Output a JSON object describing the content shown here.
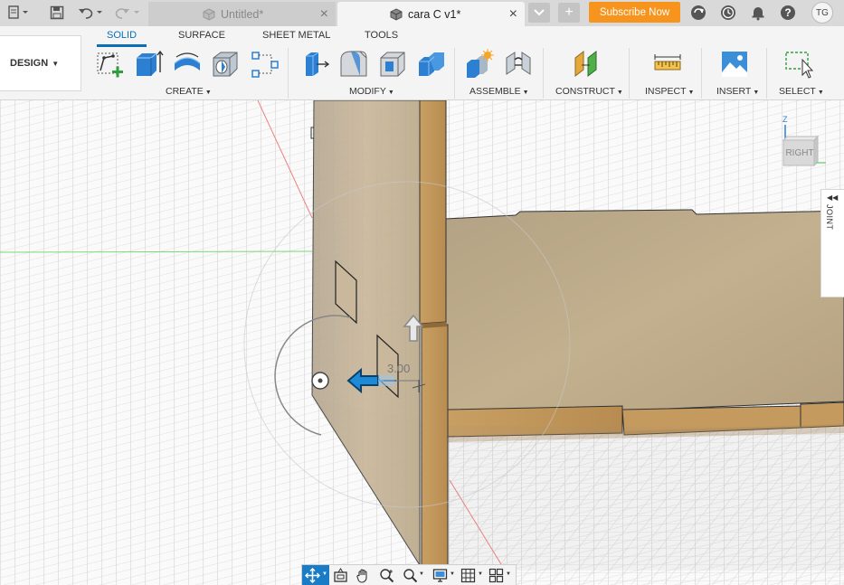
{
  "titlebar": {
    "tabs": [
      {
        "label": "Untitled*",
        "active": false
      },
      {
        "label": "cara C v1*",
        "active": true
      }
    ],
    "subscribe_label": "Subscribe Now",
    "user_initials": "TG"
  },
  "ribbon": {
    "workspace_label": "DESIGN",
    "tabs": [
      "SOLID",
      "SURFACE",
      "SHEET METAL",
      "TOOLS"
    ],
    "groups": {
      "create": "CREATE",
      "modify": "MODIFY",
      "assemble": "ASSEMBLE",
      "construct": "CONSTRUCT",
      "inspect": "INSPECT",
      "insert": "INSERT",
      "select": "SELECT"
    }
  },
  "viewport": {
    "viewcube_face": "RIGHT",
    "viewcube_axis": "Z",
    "joint_panel_label": "JOINT",
    "dimension_value": "3.00"
  },
  "colors": {
    "accent": "#0a6fb5",
    "subscribe": "#f7941d",
    "wood": "#c9a46c"
  }
}
